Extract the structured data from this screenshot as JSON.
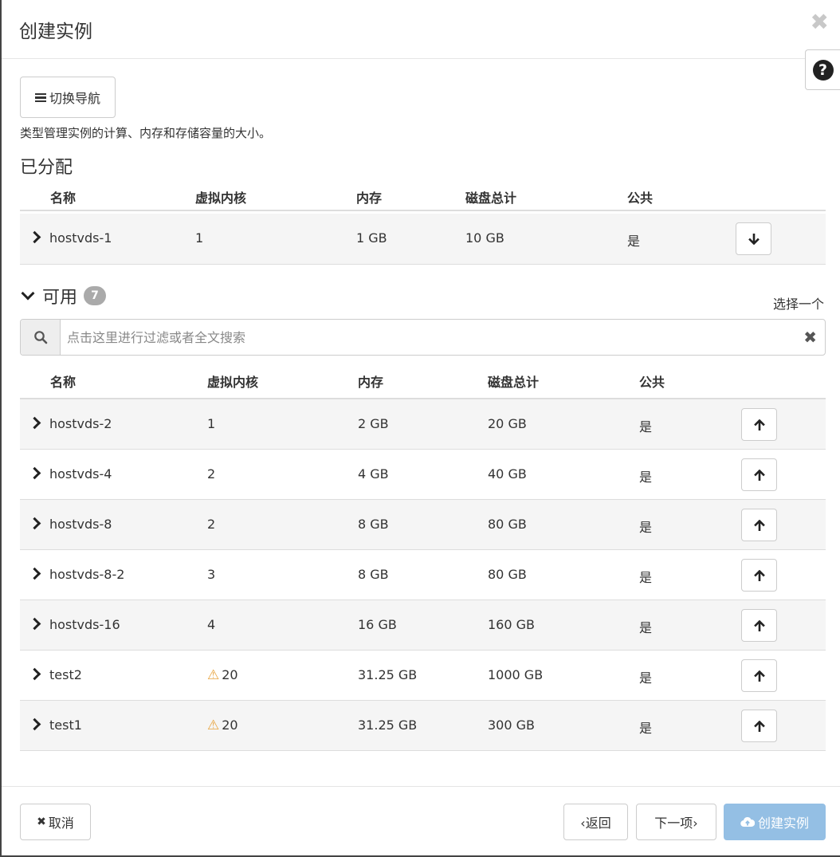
{
  "dialog": {
    "title": "创建实例",
    "close_glyph": "✖",
    "help_glyph": "?",
    "toggle_nav_label": "切换导航",
    "description": "类型管理实例的计算、内存和存储容量的大小。"
  },
  "allocated": {
    "title": "已分配",
    "columns": [
      "名称",
      "虚拟内核",
      "内存",
      "磁盘总计",
      "公共"
    ],
    "rows": [
      {
        "name": "hostvds-1",
        "vcpus": "1",
        "ram": "1 GB",
        "disk": "10 GB",
        "public": "是",
        "warning": false
      }
    ]
  },
  "available": {
    "title": "可用",
    "count": "7",
    "select_hint": "选择一个",
    "search_placeholder": "点击这里进行过滤或者全文搜索",
    "search_value": "",
    "clear_glyph": "✖",
    "columns": [
      "名称",
      "虚拟内核",
      "内存",
      "磁盘总计",
      "公共"
    ],
    "rows": [
      {
        "name": "hostvds-2",
        "vcpus": "1",
        "ram": "2 GB",
        "disk": "20 GB",
        "public": "是",
        "warning": false
      },
      {
        "name": "hostvds-4",
        "vcpus": "2",
        "ram": "4 GB",
        "disk": "40 GB",
        "public": "是",
        "warning": false
      },
      {
        "name": "hostvds-8",
        "vcpus": "2",
        "ram": "8 GB",
        "disk": "80 GB",
        "public": "是",
        "warning": false
      },
      {
        "name": "hostvds-8-2",
        "vcpus": "3",
        "ram": "8 GB",
        "disk": "80 GB",
        "public": "是",
        "warning": false
      },
      {
        "name": "hostvds-16",
        "vcpus": "4",
        "ram": "16 GB",
        "disk": "160 GB",
        "public": "是",
        "warning": false
      },
      {
        "name": "test2",
        "vcpus": "20",
        "ram": "31.25 GB",
        "disk": "1000 GB",
        "public": "是",
        "warning": true
      },
      {
        "name": "test1",
        "vcpus": "20",
        "ram": "31.25 GB",
        "disk": "300 GB",
        "public": "是",
        "warning": true
      }
    ]
  },
  "footer": {
    "cancel_label": "取消",
    "cancel_glyph": "✖",
    "back_label": "‹返回",
    "next_label": "下一项›",
    "create_label": "创建实例"
  },
  "colors": {
    "primary_disabled": "#94bfe4",
    "warning": "#e8a33d",
    "row_alt": "#f5f5f5",
    "badge": "#aaaaaa"
  },
  "icons": {
    "close": "close-icon",
    "help": "question-circle-icon",
    "nav": "bars-icon",
    "expand": "chevron-right-icon",
    "collapse": "chevron-down-icon",
    "search": "search-icon",
    "deallocate": "arrow-down-icon",
    "allocate": "arrow-up-icon",
    "warning": "warning-triangle-icon",
    "create": "cloud-upload-icon"
  }
}
